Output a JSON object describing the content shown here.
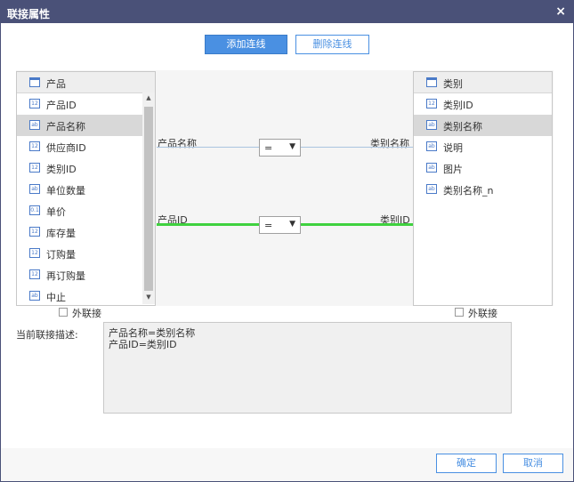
{
  "dialog": {
    "title": "联接属性",
    "close_label": "×"
  },
  "toolbar": {
    "add_label": "添加连线",
    "delete_label": "删除连线"
  },
  "left_table": {
    "name": "产品",
    "fields": [
      {
        "label": "产品ID",
        "type": "12"
      },
      {
        "label": "产品名称",
        "type": "ab"
      },
      {
        "label": "供应商ID",
        "type": "12"
      },
      {
        "label": "类别ID",
        "type": "12"
      },
      {
        "label": "单位数量",
        "type": "ab"
      },
      {
        "label": "单价",
        "type": "0.1"
      },
      {
        "label": "库存量",
        "type": "12"
      },
      {
        "label": "订购量",
        "type": "12"
      },
      {
        "label": "再订购量",
        "type": "12"
      },
      {
        "label": "中止",
        "type": "ab"
      }
    ],
    "selected": "产品名称",
    "outer_join_label": "外联接"
  },
  "right_table": {
    "name": "类别",
    "fields": [
      {
        "label": "类别ID",
        "type": "12"
      },
      {
        "label": "类别名称",
        "type": "ab"
      },
      {
        "label": "说明",
        "type": "ab"
      },
      {
        "label": "图片",
        "type": "ab"
      },
      {
        "label": "类别名称_n",
        "type": "ab"
      }
    ],
    "selected": "类别名称",
    "outer_join_label": "外联接"
  },
  "links": [
    {
      "left": "产品名称",
      "operator": "=",
      "right": "类别名称"
    },
    {
      "left": "产品ID",
      "operator": "=",
      "right": "类别ID"
    }
  ],
  "description": {
    "label": "当前联接描述:",
    "lines": [
      "产品名称=类别名称",
      "产品ID=类别ID"
    ]
  },
  "footer": {
    "ok_label": "确定",
    "cancel_label": "取消"
  },
  "colors": {
    "titlebar": "#4a5178",
    "accent": "#4a90e2",
    "active_link": "#3fd13f",
    "link": "#a9c4e0"
  }
}
